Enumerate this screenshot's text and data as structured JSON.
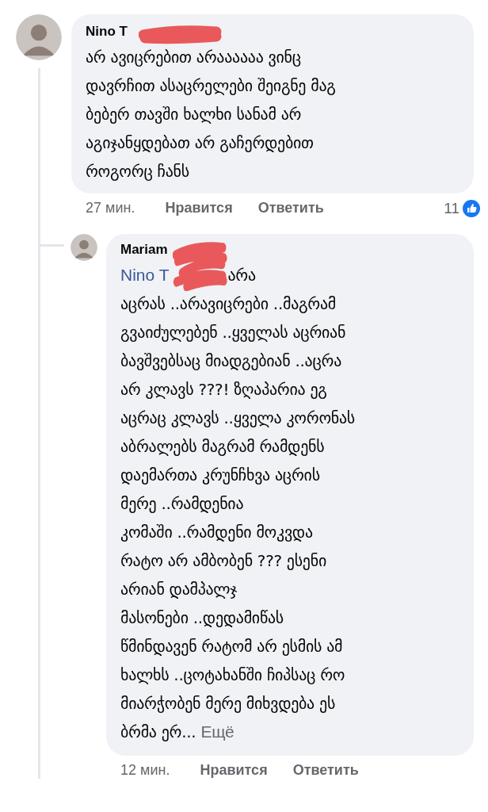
{
  "comments": [
    {
      "author": "Nino T",
      "lines": [
        "არ ავიცრებით არაააააა ვინც",
        "დავრჩით ასაცრელები შეიგნე მაგ",
        "ბებერ თავში ხალხი სანამ არ",
        "აგიჯანყდებათ არ გაჩერდებით",
        "როგორც ჩანს"
      ],
      "time": "27 мин.",
      "like": "Нравится",
      "reply": "Ответить",
      "reactions": "11",
      "children": [
        {
          "author": "Mariam",
          "mention": "Nino T",
          "mention_rest": "არა",
          "lines": [
            "აცრას ..არავიცრები ..მაგრამ",
            "გვაიძულებენ ..ყველას აცრიან",
            "ბავშვებსაც მიადგებიან ..აცრა",
            "არ კლავს ???! ზღაპარია ეგ",
            "აცრაც კლავს ..ყველა კორონას",
            "აბრალებს მაგრამ რამდენს",
            "დაემართა კრუნჩხვა აცრის",
            "მერე ..რამდენია",
            "კომაში ..რამდენი მოკვდა",
            "რატო არ ამბობენ ??? ესენი",
            "არიან დამპალჯ",
            "მასონები ..დედამიწას",
            "წმინდავენ რატომ არ ესმის ამ",
            "ხალხს ..ცოტახანში ჩიპსაც რო",
            "მიარჭობენ მერე მიხვდება ეს",
            "ბრმა ერ..."
          ],
          "more": "Ещё",
          "time": "12 мин.",
          "like": "Нравится",
          "reply": "Ответить"
        }
      ]
    }
  ]
}
